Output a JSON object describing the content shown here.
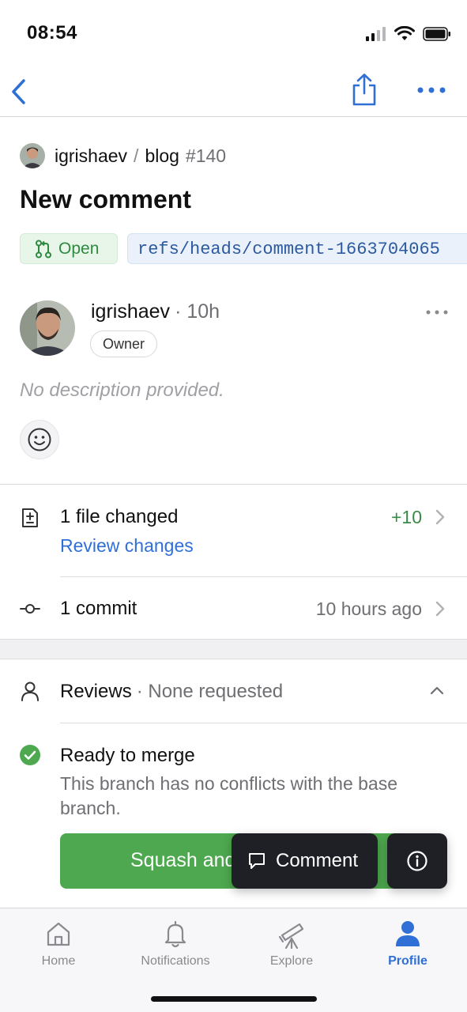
{
  "status_bar": {
    "time": "08:54"
  },
  "nav": {
    "back_icon": "chevron-left-icon",
    "share_icon": "share-icon",
    "more_icon": "ellipsis-icon"
  },
  "repo": {
    "owner": "igrishaev",
    "separator": "/",
    "name": "blog",
    "number": "#140"
  },
  "pr": {
    "title": "New comment",
    "state": "Open",
    "branch_ref": "refs/heads/comment-1663704065"
  },
  "author": {
    "name": "igrishaev",
    "time": "· 10h",
    "role": "Owner"
  },
  "description": "No description provided.",
  "files": {
    "title": "1 file changed",
    "link": "Review changes",
    "additions": "+10"
  },
  "commits": {
    "title": "1 commit",
    "time": "10 hours ago"
  },
  "reviews": {
    "label": "Reviews",
    "status": "· None requested"
  },
  "merge": {
    "title": "Ready to merge",
    "subtitle": "This branch has no conflicts with the base branch.",
    "button_label": "Squash and merge"
  },
  "fab": {
    "comment_label": "Comment"
  },
  "tabs": [
    {
      "label": "Home",
      "icon": "home-icon"
    },
    {
      "label": "Notifications",
      "icon": "bell-icon"
    },
    {
      "label": "Explore",
      "icon": "telescope-icon"
    },
    {
      "label": "Profile",
      "icon": "person-icon",
      "active": true
    }
  ],
  "colors": {
    "accent": "#2f6fd6",
    "success": "#4ea84f",
    "fab_bg": "#1e2026"
  }
}
